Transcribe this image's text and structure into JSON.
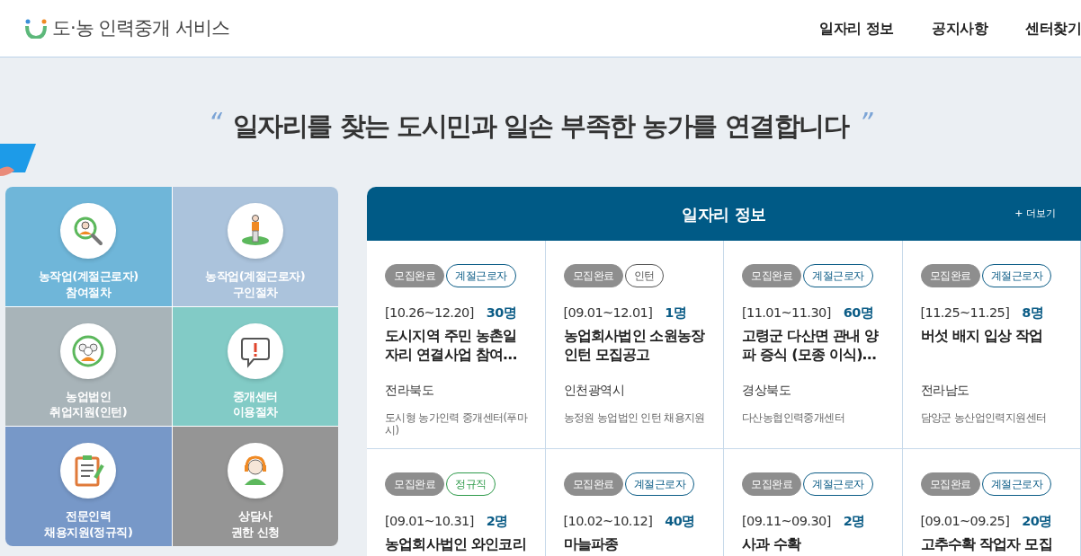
{
  "header": {
    "logo_text": "도·농 인력중개 서비스",
    "nav": [
      {
        "label": "일자리 정보"
      },
      {
        "label": "공지사항"
      },
      {
        "label": "센터찾기"
      }
    ]
  },
  "headline": {
    "open_quote": "“",
    "text": "일자리를 찾는 도시민과 일손 부족한 농가를 연결합니다",
    "close_quote": "”"
  },
  "menu": [
    {
      "label": "농작업(계절근로자)\n참여절차",
      "kind": "search",
      "color": "#6fb6d9"
    },
    {
      "label": "농작업(계절근로자)\n구인절차",
      "kind": "person",
      "color": "#abc3dc"
    },
    {
      "label": "농업법인\n취업지원(인턴)",
      "kind": "group",
      "color": "#a8b4b9"
    },
    {
      "label": "중개센터\n이용절차",
      "kind": "alert",
      "color": "#82cbc6"
    },
    {
      "label": "전문인력\n채용지원(정규직)",
      "kind": "clipboard",
      "color": "#7798c8"
    },
    {
      "label": "상담사\n권한 신청",
      "kind": "headset",
      "color": "#959595"
    }
  ],
  "jobs": {
    "title": "일자리 정보",
    "more": "+ 더보기",
    "cards": [
      {
        "status": "모집완료",
        "type": "계절근로자",
        "color": "#0b5c86",
        "period": "[10.26~12.20]",
        "count": "30명",
        "title": "도시지역 주민 농촌일자리 연결사업 참여…",
        "region": "전라북도",
        "org": "도시형 농가인력 중개센터(푸마시)"
      },
      {
        "status": "모집완료",
        "type": "인턴",
        "color": "#555555",
        "period": "[09.01~12.01]",
        "count": "1명",
        "title": "농업회사법인 소원농장 인턴 모집공고",
        "region": "인천광역시",
        "org": "농정원 농업법인 인턴 채용지원"
      },
      {
        "status": "모집완료",
        "type": "계절근로자",
        "color": "#0b5c86",
        "period": "[11.01~11.30]",
        "count": "60명",
        "title": "고령군 다산면 관내 양파 증식 (모종 이식)…",
        "region": "경상북도",
        "org": "다산농협인력중개센터"
      },
      {
        "status": "모집완료",
        "type": "계절근로자",
        "color": "#0b5c86",
        "period": "[11.25~11.25]",
        "count": "8명",
        "title": "버섯 배지 입상 작업",
        "region": "전라남도",
        "org": "담양군 농산업인력지원센터"
      },
      {
        "status": "모집완료",
        "type": "정규직",
        "color": "#2e9a4a",
        "period": "[09.01~10.31]",
        "count": "2명",
        "title": "농업회사법인 와인코리"
      },
      {
        "status": "모집완료",
        "type": "계절근로자",
        "color": "#0b5c86",
        "period": "[10.02~10.12]",
        "count": "40명",
        "title": "마늘파종"
      },
      {
        "status": "모집완료",
        "type": "계절근로자",
        "color": "#0b5c86",
        "period": "[09.11~09.30]",
        "count": "2명",
        "title": "사과 수확"
      },
      {
        "status": "모집완료",
        "type": "계절근로자",
        "color": "#0b5c86",
        "period": "[09.01~09.25]",
        "count": "20명",
        "title": "고추수확 작업자 모집"
      }
    ]
  }
}
